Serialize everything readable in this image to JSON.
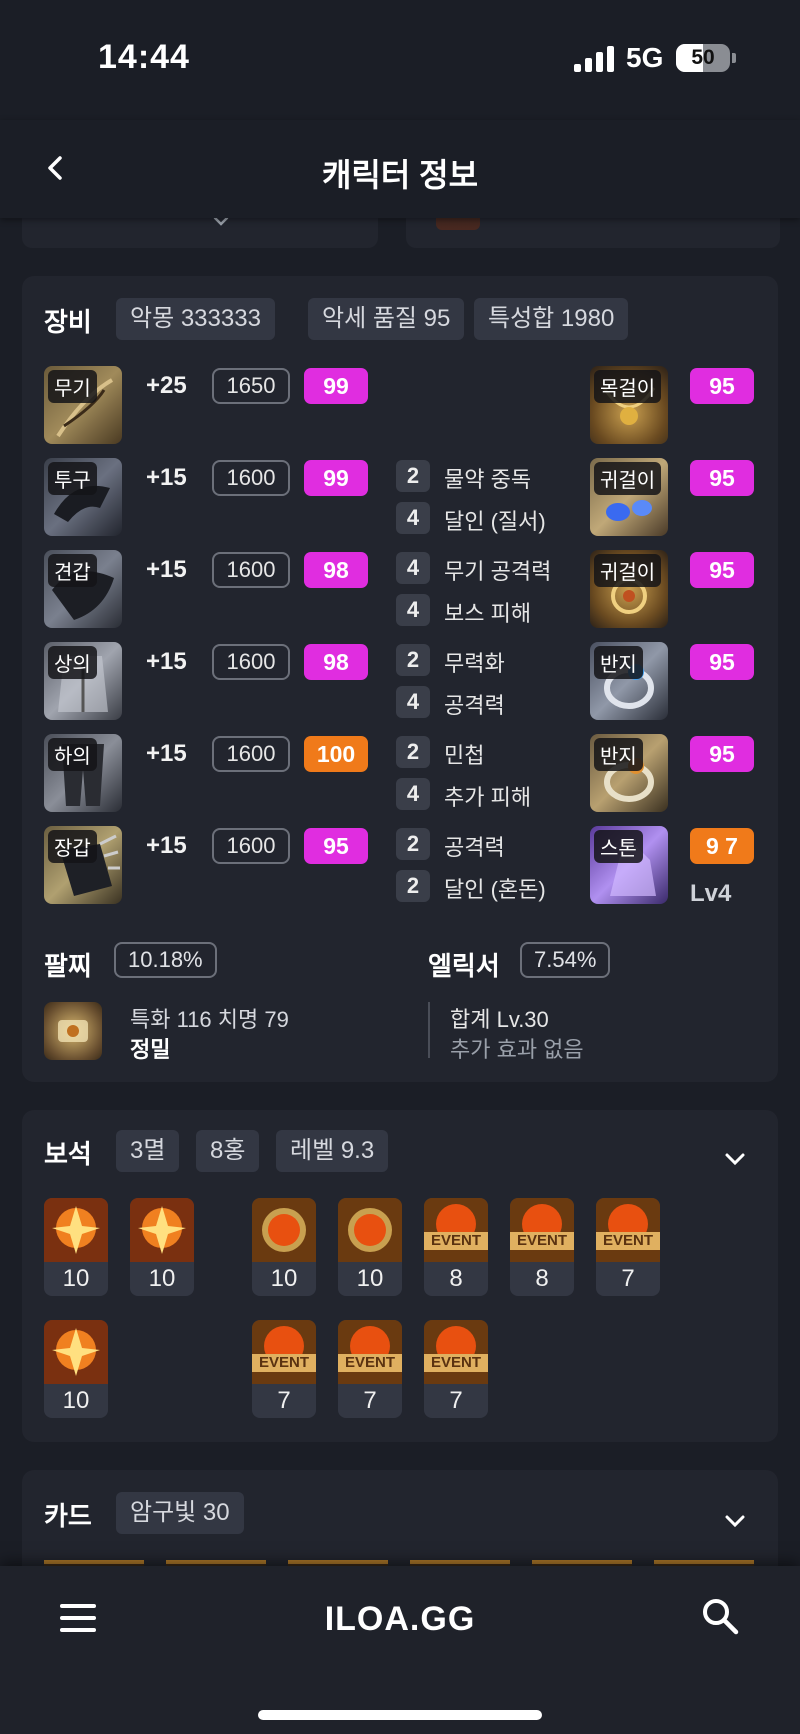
{
  "status_bar": {
    "time": "14:44",
    "network": "5G",
    "battery": "50"
  },
  "header": {
    "title": "캐릭터 정보"
  },
  "equipment": {
    "title": "장비",
    "chips": [
      "악몽 333333",
      "악세 품질 95",
      "특성합 1980"
    ],
    "left_items": [
      {
        "slot": "무기",
        "honing": "+25",
        "item_level": "1650",
        "quality": "99",
        "quality_color": "magenta"
      },
      {
        "slot": "투구",
        "honing": "+15",
        "item_level": "1600",
        "quality": "99",
        "quality_color": "magenta"
      },
      {
        "slot": "견갑",
        "honing": "+15",
        "item_level": "1600",
        "quality": "98",
        "quality_color": "magenta"
      },
      {
        "slot": "상의",
        "honing": "+15",
        "item_level": "1600",
        "quality": "98",
        "quality_color": "magenta"
      },
      {
        "slot": "하의",
        "honing": "+15",
        "item_level": "1600",
        "quality": "100",
        "quality_color": "orange"
      },
      {
        "slot": "장갑",
        "honing": "+15",
        "item_level": "1600",
        "quality": "95",
        "quality_color": "magenta"
      }
    ],
    "engravings": [
      {
        "level": "2",
        "name": "물약 중독"
      },
      {
        "level": "4",
        "name": "달인 (질서)"
      },
      {
        "level": "4",
        "name": "무기 공격력"
      },
      {
        "level": "4",
        "name": "보스 피해"
      },
      {
        "level": "2",
        "name": "무력화"
      },
      {
        "level": "4",
        "name": "공격력"
      },
      {
        "level": "2",
        "name": "민첩"
      },
      {
        "level": "4",
        "name": "추가 피해"
      },
      {
        "level": "2",
        "name": "공격력"
      },
      {
        "level": "2",
        "name": "달인 (혼돈)"
      }
    ],
    "accessories": [
      {
        "slot": "목걸이",
        "quality": "95"
      },
      {
        "slot": "귀걸이",
        "quality": "95"
      },
      {
        "slot": "귀걸이",
        "quality": "95"
      },
      {
        "slot": "반지",
        "quality": "95"
      },
      {
        "slot": "반지",
        "quality": "95"
      }
    ],
    "stone": {
      "slot": "스톤",
      "value": "9 7",
      "level": "Lv4"
    },
    "bracelet": {
      "title": "팔찌",
      "percent": "10.18%",
      "stats": "특화 116   치명 79",
      "effect": "정밀"
    },
    "elixir": {
      "title": "엘릭서",
      "percent": "7.54%",
      "total": "합계 Lv.30",
      "effect": "추가 효과 없음"
    }
  },
  "gems": {
    "title": "보석",
    "chips": [
      "3멸",
      "8홍",
      "레벨 9.3"
    ],
    "row1": [
      {
        "type": "damage",
        "level": "10",
        "event": ""
      },
      {
        "type": "damage",
        "level": "10",
        "event": ""
      },
      {
        "type": "cooldown",
        "level": "10",
        "event": ""
      },
      {
        "type": "cooldown",
        "level": "10",
        "event": ""
      },
      {
        "type": "cooldown",
        "level": "8",
        "event": "EVENT"
      },
      {
        "type": "cooldown",
        "level": "8",
        "event": "EVENT"
      },
      {
        "type": "cooldown",
        "level": "7",
        "event": "EVENT"
      }
    ],
    "row2": [
      {
        "type": "damage",
        "level": "10",
        "event": ""
      },
      {
        "type": "cooldown",
        "level": "7",
        "event": "EVENT"
      },
      {
        "type": "cooldown",
        "level": "7",
        "event": "EVENT"
      },
      {
        "type": "cooldown",
        "level": "7",
        "event": "EVENT"
      }
    ]
  },
  "cards": {
    "title": "카드",
    "chips": [
      "암구빛 30"
    ]
  },
  "bottom_nav": {
    "logo": "ILOA.GG"
  },
  "colors": {
    "magenta": "#e02de0",
    "orange": "#f07a1a",
    "background": "#1b1e26",
    "card": "#22252e"
  }
}
